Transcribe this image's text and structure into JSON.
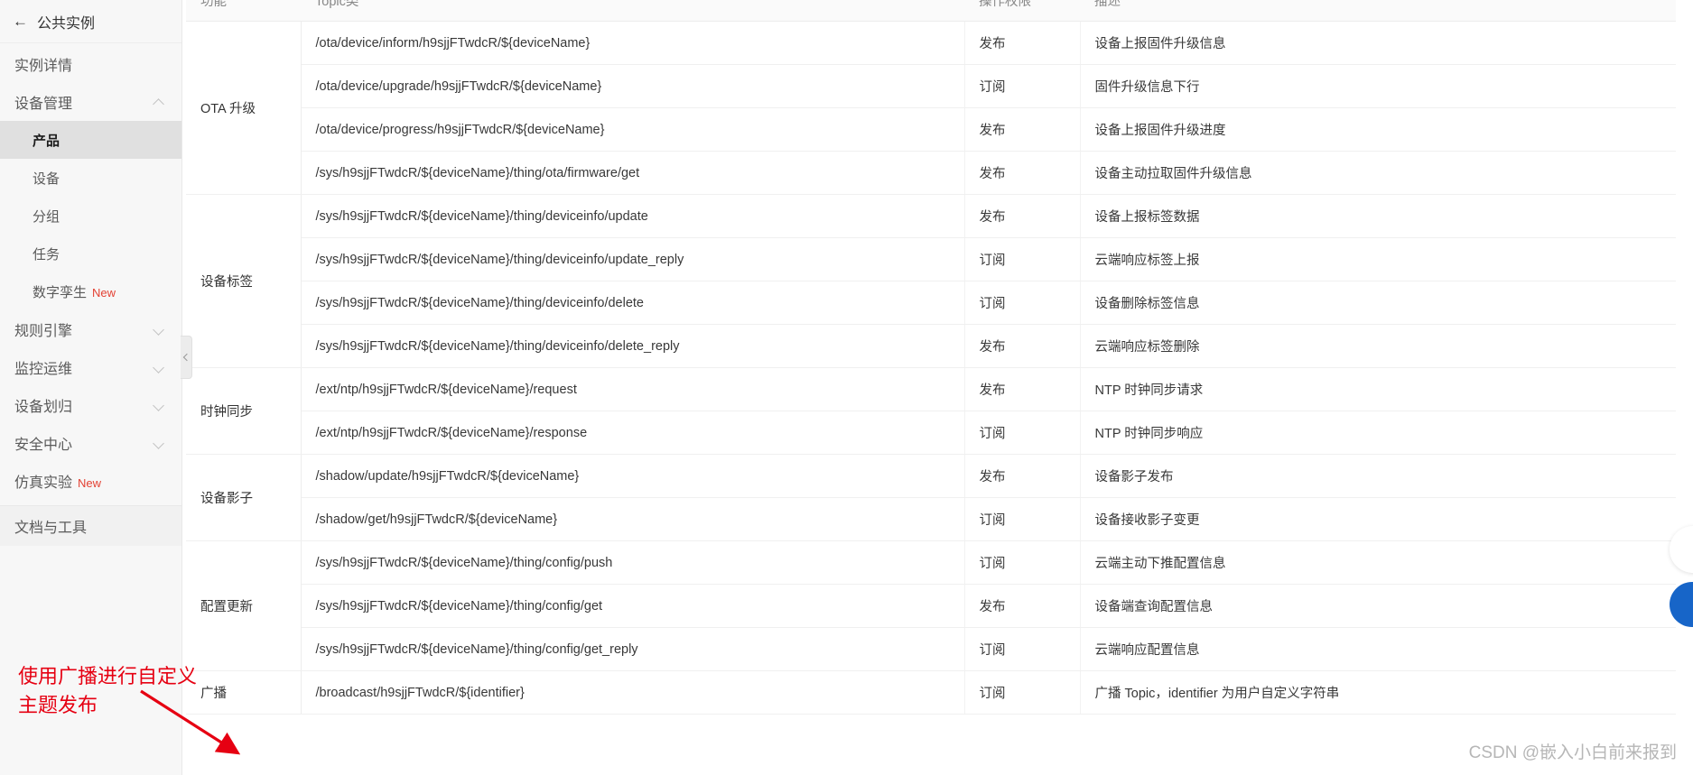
{
  "sidebar": {
    "back": {
      "label": "公共实例",
      "icon": "back-arrow-icon"
    },
    "items": [
      {
        "label": "实例详情",
        "level": "top",
        "chevron": "",
        "badge": "",
        "active": false
      },
      {
        "label": "设备管理",
        "level": "top",
        "chevron": "up",
        "badge": "",
        "active": false
      },
      {
        "label": "产品",
        "level": "child",
        "chevron": "",
        "badge": "",
        "active": true
      },
      {
        "label": "设备",
        "level": "child",
        "chevron": "",
        "badge": "",
        "active": false
      },
      {
        "label": "分组",
        "level": "child",
        "chevron": "",
        "badge": "",
        "active": false
      },
      {
        "label": "任务",
        "level": "child",
        "chevron": "",
        "badge": "",
        "active": false
      },
      {
        "label": "数字孪生",
        "level": "child",
        "chevron": "",
        "badge": "New",
        "active": false
      },
      {
        "label": "规则引擎",
        "level": "top",
        "chevron": "down",
        "badge": "",
        "active": false
      },
      {
        "label": "监控运维",
        "level": "top",
        "chevron": "down",
        "badge": "",
        "active": false
      },
      {
        "label": "设备划归",
        "level": "top",
        "chevron": "down",
        "badge": "",
        "active": false
      },
      {
        "label": "安全中心",
        "level": "top",
        "chevron": "down",
        "badge": "",
        "active": false
      },
      {
        "label": "仿真实验",
        "level": "top",
        "chevron": "",
        "badge": "New",
        "active": false
      }
    ],
    "footer_item": {
      "label": "文档与工具"
    }
  },
  "table": {
    "headers": [
      "功能",
      "Topic类",
      "操作权限",
      "描述"
    ],
    "rows": [
      {
        "func": "OTA 升级",
        "rowspan": 4,
        "topic": "/ota/device/inform/h9sjjFTwdcR/${deviceName}",
        "perm": "发布",
        "desc": "设备上报固件升级信息"
      },
      {
        "func": "",
        "rowspan": 0,
        "topic": "/ota/device/upgrade/h9sjjFTwdcR/${deviceName}",
        "perm": "订阅",
        "desc": "固件升级信息下行"
      },
      {
        "func": "",
        "rowspan": 0,
        "topic": "/ota/device/progress/h9sjjFTwdcR/${deviceName}",
        "perm": "发布",
        "desc": "设备上报固件升级进度"
      },
      {
        "func": "",
        "rowspan": 0,
        "topic": "/sys/h9sjjFTwdcR/${deviceName}/thing/ota/firmware/get",
        "perm": "发布",
        "desc": "设备主动拉取固件升级信息"
      },
      {
        "func": "设备标签",
        "rowspan": 4,
        "topic": "/sys/h9sjjFTwdcR/${deviceName}/thing/deviceinfo/update",
        "perm": "发布",
        "desc": "设备上报标签数据"
      },
      {
        "func": "",
        "rowspan": 0,
        "topic": "/sys/h9sjjFTwdcR/${deviceName}/thing/deviceinfo/update_reply",
        "perm": "订阅",
        "desc": "云端响应标签上报"
      },
      {
        "func": "",
        "rowspan": 0,
        "topic": "/sys/h9sjjFTwdcR/${deviceName}/thing/deviceinfo/delete",
        "perm": "订阅",
        "desc": "设备删除标签信息"
      },
      {
        "func": "",
        "rowspan": 0,
        "topic": "/sys/h9sjjFTwdcR/${deviceName}/thing/deviceinfo/delete_reply",
        "perm": "发布",
        "desc": "云端响应标签删除"
      },
      {
        "func": "时钟同步",
        "rowspan": 2,
        "topic": "/ext/ntp/h9sjjFTwdcR/${deviceName}/request",
        "perm": "发布",
        "desc": "NTP 时钟同步请求"
      },
      {
        "func": "",
        "rowspan": 0,
        "topic": "/ext/ntp/h9sjjFTwdcR/${deviceName}/response",
        "perm": "订阅",
        "desc": "NTP 时钟同步响应"
      },
      {
        "func": "设备影子",
        "rowspan": 2,
        "topic": "/shadow/update/h9sjjFTwdcR/${deviceName}",
        "perm": "发布",
        "desc": "设备影子发布"
      },
      {
        "func": "",
        "rowspan": 0,
        "topic": "/shadow/get/h9sjjFTwdcR/${deviceName}",
        "perm": "订阅",
        "desc": "设备接收影子变更"
      },
      {
        "func": "配置更新",
        "rowspan": 3,
        "topic": "/sys/h9sjjFTwdcR/${deviceName}/thing/config/push",
        "perm": "订阅",
        "desc": "云端主动下推配置信息"
      },
      {
        "func": "",
        "rowspan": 0,
        "topic": "/sys/h9sjjFTwdcR/${deviceName}/thing/config/get",
        "perm": "发布",
        "desc": "设备端查询配置信息"
      },
      {
        "func": "",
        "rowspan": 0,
        "topic": "/sys/h9sjjFTwdcR/${deviceName}/thing/config/get_reply",
        "perm": "订阅",
        "desc": "云端响应配置信息"
      },
      {
        "func": "广播",
        "rowspan": 1,
        "topic": "/broadcast/h9sjjFTwdcR/${identifier}",
        "perm": "订阅",
        "desc": "广播 Topic，identifier 为用户自定义字符串"
      }
    ]
  },
  "annotation": {
    "line1": "使用广播进行自定义",
    "line2": "主题发布",
    "color": "#e60012"
  },
  "watermark": {
    "text": "CSDN @嵌入小白前来报到"
  }
}
